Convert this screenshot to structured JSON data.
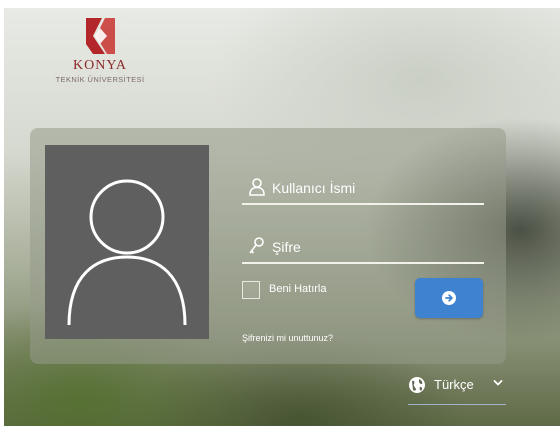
{
  "logo": {
    "name": "KONYA",
    "subtitle": "TEKNİK ÜNİVERSİTESİ",
    "color": "#b3262a"
  },
  "login": {
    "username_placeholder": "Kullanıcı İsmi",
    "password_placeholder": "Şifre",
    "remember_label": "Beni Hatırla",
    "forgot_label": "Şifrenizi mi unuttunuz?",
    "submit_icon": "arrow-right-circle-icon"
  },
  "language": {
    "selected": "Türkçe",
    "icon": "globe-icon"
  },
  "colors": {
    "accent": "#3f82d0",
    "avatar_bg": "#5f5f5f"
  }
}
